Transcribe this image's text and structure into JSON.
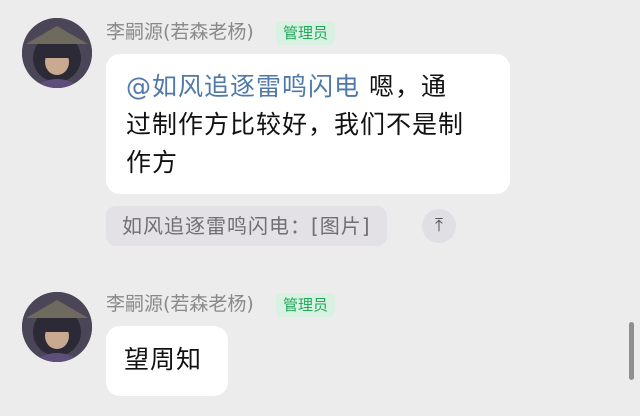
{
  "messages": [
    {
      "sender": "李嗣源(若森老杨)",
      "badge": "管理员",
      "mention": "@如风追逐雷鸣闪电",
      "text_lines": [
        "嗯，通",
        "过制作方比较好，我们不是制",
        "作方"
      ],
      "quote": "如风追逐雷鸣闪电：[图片]",
      "jump_icon": "arrow-up-to-top-icon",
      "jump_glyph": "⤒"
    },
    {
      "sender": "李嗣源(若森老杨)",
      "badge": "管理员",
      "text": "望周知"
    }
  ],
  "colors": {
    "background": "#ececec",
    "bubble": "#ffffff",
    "mention": "#4f79a8",
    "badge_bg": "#d9f1e3",
    "badge_text": "#23a85a",
    "sender_text": "#8a8a8a"
  }
}
